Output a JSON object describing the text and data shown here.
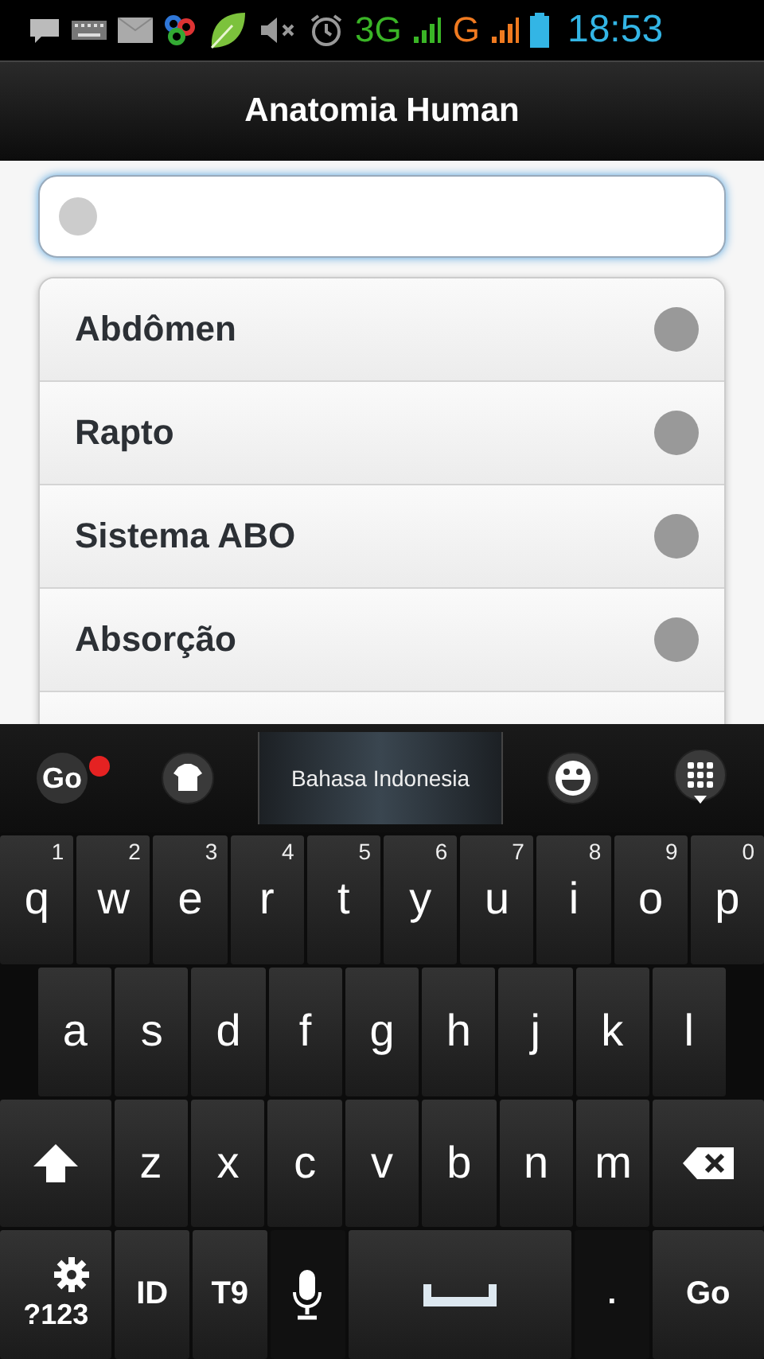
{
  "status_bar": {
    "network_3g": "3G",
    "network_g": "G",
    "time": "18:53"
  },
  "title": "Anatomia Human",
  "list": [
    {
      "label": "Abdômen"
    },
    {
      "label": "Rapto"
    },
    {
      "label": "Sistema ABO"
    },
    {
      "label": "Absorção"
    }
  ],
  "keyboard": {
    "toolbar": {
      "logo": "Go",
      "notification": true,
      "language": "Bahasa Indonesia"
    },
    "rows": [
      [
        {
          "kind": "letter",
          "label": "q",
          "hint": "1"
        },
        {
          "kind": "letter",
          "label": "w",
          "hint": "2"
        },
        {
          "kind": "letter",
          "label": "e",
          "hint": "3"
        },
        {
          "kind": "letter",
          "label": "r",
          "hint": "4"
        },
        {
          "kind": "letter",
          "label": "t",
          "hint": "5"
        },
        {
          "kind": "letter",
          "label": "y",
          "hint": "6"
        },
        {
          "kind": "letter",
          "label": "u",
          "hint": "7"
        },
        {
          "kind": "letter",
          "label": "i",
          "hint": "8"
        },
        {
          "kind": "letter",
          "label": "o",
          "hint": "9"
        },
        {
          "kind": "letter",
          "label": "p",
          "hint": "0"
        }
      ],
      [
        {
          "kind": "letter",
          "label": "a"
        },
        {
          "kind": "letter",
          "label": "s"
        },
        {
          "kind": "letter",
          "label": "d"
        },
        {
          "kind": "letter",
          "label": "f"
        },
        {
          "kind": "letter",
          "label": "g"
        },
        {
          "kind": "letter",
          "label": "h"
        },
        {
          "kind": "letter",
          "label": "j"
        },
        {
          "kind": "letter",
          "label": "k"
        },
        {
          "kind": "letter",
          "label": "l"
        }
      ],
      [
        {
          "kind": "shift"
        },
        {
          "kind": "letter",
          "label": "z"
        },
        {
          "kind": "letter",
          "label": "x"
        },
        {
          "kind": "letter",
          "label": "c"
        },
        {
          "kind": "letter",
          "label": "v"
        },
        {
          "kind": "letter",
          "label": "b"
        },
        {
          "kind": "letter",
          "label": "n"
        },
        {
          "kind": "letter",
          "label": "m"
        },
        {
          "kind": "backspace"
        }
      ]
    ],
    "bottom_row": [
      {
        "kind": "symbols",
        "label": "?123"
      },
      {
        "kind": "text",
        "label": "ID"
      },
      {
        "kind": "text",
        "label": "T9"
      },
      {
        "kind": "mic"
      },
      {
        "kind": "space"
      },
      {
        "kind": "text",
        "label": "."
      },
      {
        "kind": "action",
        "label": "Go"
      }
    ]
  }
}
